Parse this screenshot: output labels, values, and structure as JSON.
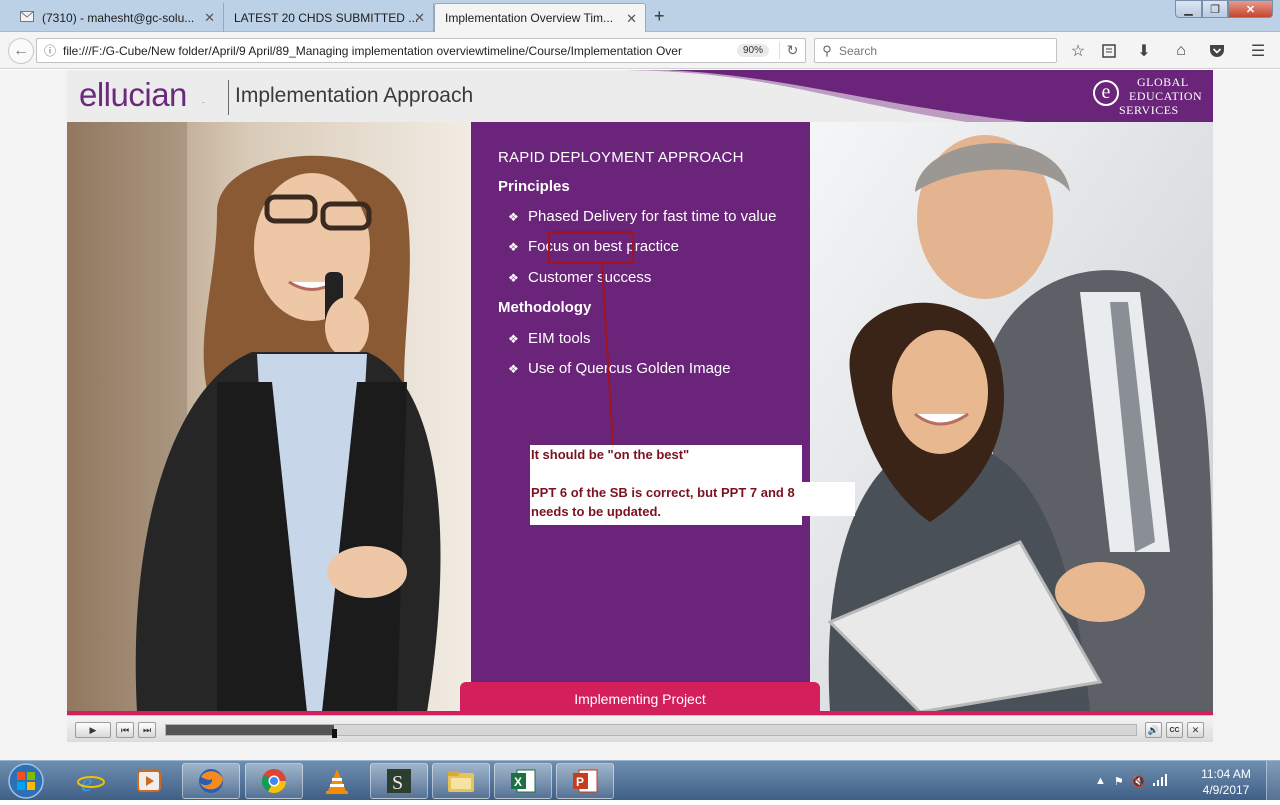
{
  "browser": {
    "tabs": [
      {
        "label": "(7310) - mahesht@gc-solu...",
        "active": false
      },
      {
        "label": "LATEST 20 CHDS SUBMITTED ...",
        "active": false
      },
      {
        "label": "Implementation Overview Tim...",
        "active": true
      }
    ],
    "new_tab_glyph": "+",
    "close_glyph": "✕",
    "url": "file:///F:/G-Cube/New folder/April/9 April/89_Managing implementation overviewtimeline/Course/Implementation Over",
    "zoom": "90%",
    "search_placeholder": "Search",
    "toolbar_icons": [
      "bookmark-star-icon",
      "reading-list-icon",
      "download-icon",
      "home-icon",
      "pocket-icon",
      "menu-icon"
    ]
  },
  "slide": {
    "logo_text": "ellucian",
    "logo_reg": ".",
    "title": "Implementation Approach",
    "partner_logo": {
      "letter": "e",
      "line1": "GLOBAL",
      "line2": "EDUCATION",
      "line3": "SERVICES"
    },
    "heading": "RAPID DEPLOYMENT APPROACH",
    "bullet_glyph": "❖",
    "sections": [
      {
        "title": "Principles",
        "items": [
          "Phased Delivery for fast time to value",
          "Focus on best practice",
          "Customer success"
        ]
      },
      {
        "title": "Methodology",
        "items": [
          "EIM tools",
          "Use of Quercus Golden Image"
        ]
      }
    ],
    "review_note": {
      "line1": "It should be \"on the best\"",
      "line2": "PPT 6 of the SB is correct, but PPT 7  and 8",
      "line3": "needs to be updated."
    },
    "bottom_tab": "Implementing Project",
    "colors": {
      "purple": "#6a2479",
      "pink": "#d31f5c",
      "review_red": "#a3131e"
    }
  },
  "player": {
    "progress_fraction": 0.173,
    "buttons": [
      "play-icon",
      "previous-icon",
      "next-icon",
      "volume-icon",
      "closed-captions-icon",
      "close-icon"
    ],
    "cc_label": "CC"
  },
  "taskbar": {
    "apps": [
      "internet-explorer-icon",
      "media-player-icon",
      "firefox-icon",
      "chrome-icon",
      "vlc-icon",
      "app-s-icon",
      "file-explorer-icon",
      "excel-icon",
      "powerpoint-icon"
    ],
    "clock_time": "11:04 AM",
    "clock_date": "4/9/2017"
  }
}
